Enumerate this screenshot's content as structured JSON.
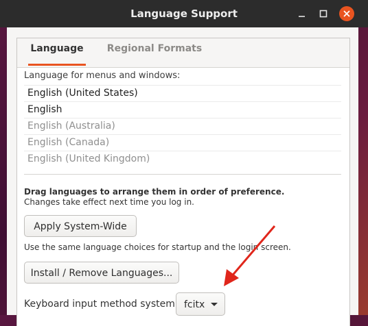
{
  "window": {
    "title": "Language Support",
    "controls": [
      "minimize-icon",
      "maximize-icon",
      "close-icon"
    ],
    "accent_color": "#e95420"
  },
  "tabs": [
    {
      "label": "Language",
      "active": true
    },
    {
      "label": "Regional Formats",
      "active": false
    }
  ],
  "language": {
    "list_label": "Language for menus and windows:",
    "languages": [
      {
        "name": "English (United States)",
        "enabled": true
      },
      {
        "name": "English",
        "enabled": true
      },
      {
        "name": "English (Australia)",
        "enabled": false
      },
      {
        "name": "English (Canada)",
        "enabled": false
      },
      {
        "name": "English (United Kingdom)",
        "enabled": false
      }
    ],
    "hint_bold": "Drag languages to arrange them in order of preference.",
    "hint": "Changes take effect next time you log in.",
    "apply_button": "Apply System-Wide",
    "apply_hint": "Use the same language choices for startup and the login screen.",
    "install_button": "Install / Remove Languages...",
    "keyboard_label": "Keyboard input method system:",
    "keyboard_value": "fcitx"
  },
  "annotation": {
    "color": "#e0261b",
    "icon": "red-arrow-pointer"
  }
}
